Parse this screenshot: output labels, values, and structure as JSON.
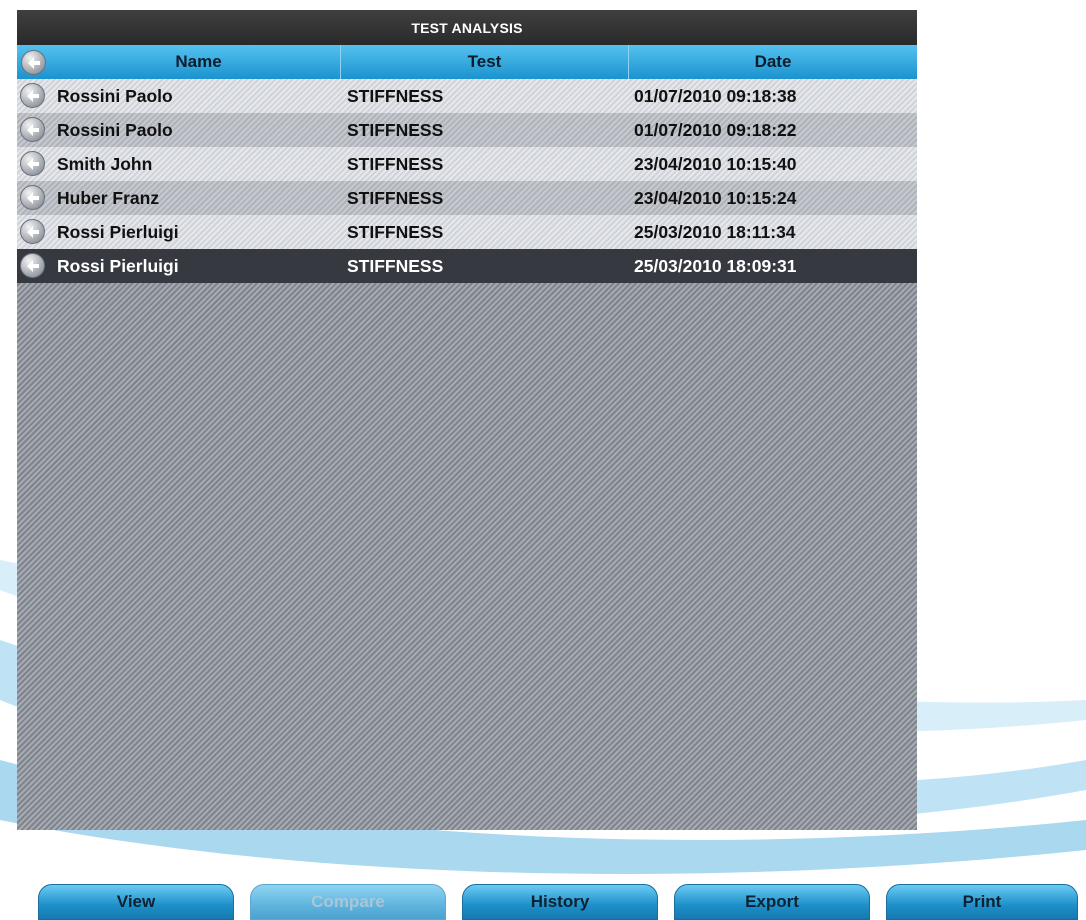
{
  "panel": {
    "title": "TEST ANALYSIS"
  },
  "columns": {
    "name": "Name",
    "test": "Test",
    "date": "Date"
  },
  "rows": [
    {
      "name": "Rossini Paolo",
      "test": "STIFFNESS",
      "date": "01/07/2010 09:18:38"
    },
    {
      "name": "Rossini Paolo",
      "test": "STIFFNESS",
      "date": "01/07/2010 09:18:22"
    },
    {
      "name": "Smith John",
      "test": "STIFFNESS",
      "date": "23/04/2010 10:15:40"
    },
    {
      "name": "Huber Franz",
      "test": "STIFFNESS",
      "date": "23/04/2010 10:15:24"
    },
    {
      "name": "Rossi Pierluigi",
      "test": "STIFFNESS",
      "date": "25/03/2010 18:11:34"
    },
    {
      "name": "Rossi Pierluigi",
      "test": "STIFFNESS",
      "date": "25/03/2010 18:09:31"
    }
  ],
  "selected_row": 5,
  "toolbar": {
    "view": "View",
    "compare": "Compare",
    "history": "History",
    "export": "Export",
    "print": "Print"
  },
  "icons": {
    "row_arrow": "left-arrow-icon",
    "header_arrow": "back-arrow-icon"
  },
  "colors": {
    "header_blue": "#1b93cf",
    "title_bar": "#2a2a2a",
    "selected_row": "#363a40"
  }
}
